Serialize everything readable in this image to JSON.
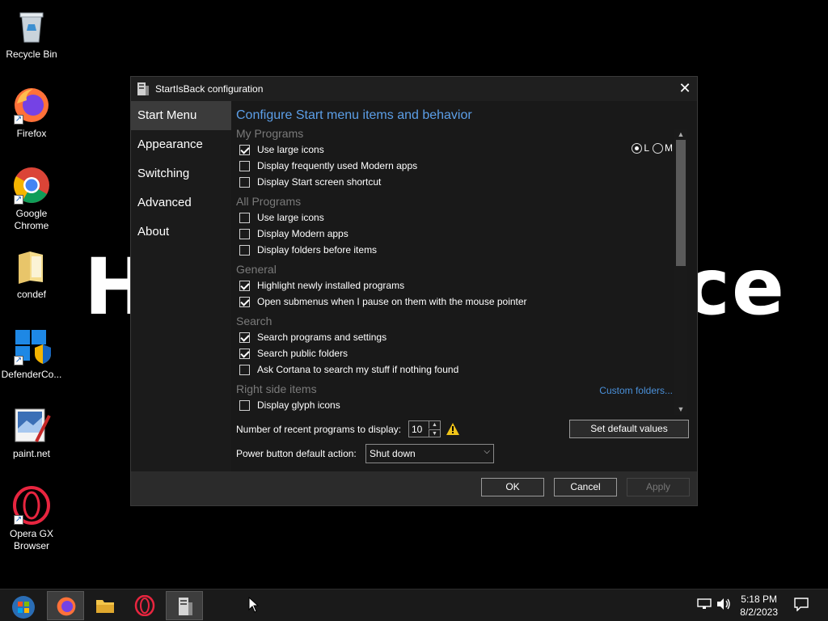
{
  "desktop": {
    "wallpaper_text": "H                              ce",
    "icons": [
      {
        "label": "Recycle Bin",
        "icon": "recycle-bin-icon"
      },
      {
        "label": "Firefox",
        "icon": "firefox-icon"
      },
      {
        "label": "Google Chrome",
        "icon": "chrome-icon"
      },
      {
        "label": "condef",
        "icon": "folder-icon"
      },
      {
        "label": "DefenderCo...",
        "icon": "defender-icon"
      },
      {
        "label": "paint.net",
        "icon": "paint-net-icon"
      },
      {
        "label": "Opera GX Browser",
        "icon": "opera-gx-icon"
      }
    ]
  },
  "window": {
    "title": "StartIsBack configuration",
    "close_label": "✕",
    "sidebar": {
      "items": [
        {
          "label": "Start Menu",
          "active": true
        },
        {
          "label": "Appearance",
          "active": false
        },
        {
          "label": "Switching",
          "active": false
        },
        {
          "label": "Advanced",
          "active": false
        },
        {
          "label": "About",
          "active": false
        }
      ]
    },
    "main": {
      "heading": "Configure Start menu items and behavior",
      "sections": {
        "my_programs": {
          "header": "My Programs",
          "options": [
            {
              "label": "Use large icons",
              "checked": true
            },
            {
              "label": "Display frequently used Modern apps",
              "checked": false
            },
            {
              "label": "Display Start screen shortcut",
              "checked": false
            }
          ],
          "icon_size": {
            "options": [
              "L",
              "M"
            ],
            "selected": "L"
          }
        },
        "all_programs": {
          "header": "All Programs",
          "options": [
            {
              "label": "Use large icons",
              "checked": false
            },
            {
              "label": "Display Modern apps",
              "checked": false
            },
            {
              "label": "Display folders before items",
              "checked": false
            }
          ]
        },
        "general": {
          "header": "General",
          "options": [
            {
              "label": "Highlight newly installed programs",
              "checked": true
            },
            {
              "label": "Open submenus when I pause on them with the mouse pointer",
              "checked": true
            }
          ]
        },
        "search": {
          "header": "Search",
          "options": [
            {
              "label": "Search programs and settings",
              "checked": true
            },
            {
              "label": "Search public folders",
              "checked": true
            },
            {
              "label": "Ask Cortana to search my stuff if nothing found",
              "checked": false
            }
          ]
        },
        "right_side": {
          "header": "Right side items",
          "link": "Custom folders...",
          "options": [
            {
              "label": "Display glyph icons",
              "checked": false
            }
          ]
        }
      },
      "recent_programs": {
        "label": "Number of recent programs to display:",
        "value": "10"
      },
      "set_default_label": "Set default values",
      "power_button": {
        "label": "Power button default action:",
        "value": "Shut down"
      }
    },
    "footer": {
      "ok": "OK",
      "cancel": "Cancel",
      "apply": "Apply"
    }
  },
  "taskbar": {
    "items": [
      "start-orb-icon",
      "firefox-icon",
      "file-explorer-icon",
      "opera-icon",
      "startisback-config-icon"
    ],
    "time": "5:18 PM",
    "date": "8/2/2023"
  },
  "colors": {
    "accent": "#5c9fe8",
    "link": "#4a90d9",
    "section_header": "#7a7a7a"
  }
}
